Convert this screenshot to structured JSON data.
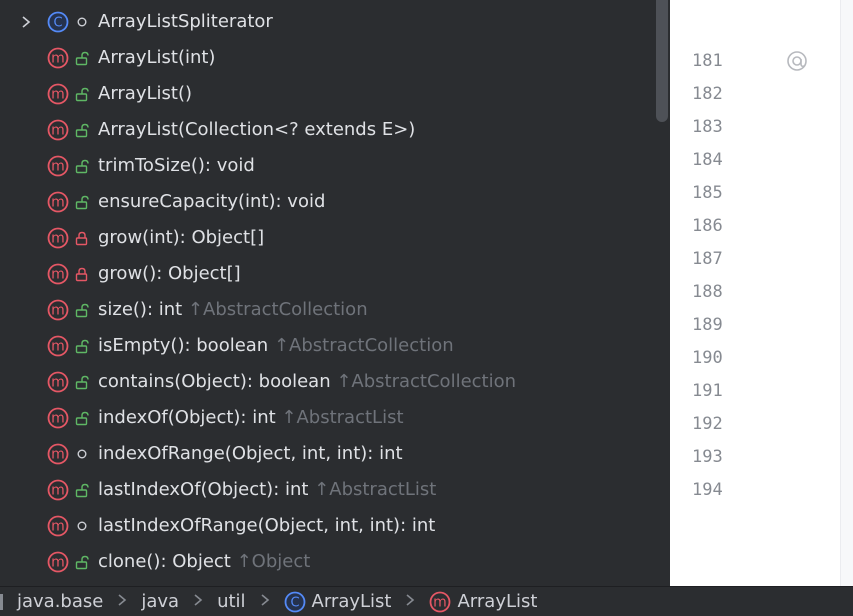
{
  "structure": {
    "items": [
      {
        "kind": "class",
        "visibility": "package",
        "label": "ArrayListSpliterator",
        "suffix": "",
        "expander": true
      },
      {
        "kind": "method",
        "visibility": "public",
        "label": "ArrayList(int)",
        "suffix": ""
      },
      {
        "kind": "method",
        "visibility": "public",
        "label": "ArrayList()",
        "suffix": ""
      },
      {
        "kind": "method",
        "visibility": "public",
        "label": "ArrayList(Collection<? extends E>)",
        "suffix": ""
      },
      {
        "kind": "method",
        "visibility": "public",
        "label": "trimToSize(): void",
        "suffix": ""
      },
      {
        "kind": "method",
        "visibility": "public",
        "label": "ensureCapacity(int): void",
        "suffix": ""
      },
      {
        "kind": "method",
        "visibility": "private",
        "label": "grow(int): Object[]",
        "suffix": ""
      },
      {
        "kind": "method",
        "visibility": "private",
        "label": "grow(): Object[]",
        "suffix": ""
      },
      {
        "kind": "method",
        "visibility": "public",
        "label": "size(): int",
        "suffix": "↑AbstractCollection"
      },
      {
        "kind": "method",
        "visibility": "public",
        "label": "isEmpty(): boolean",
        "suffix": "↑AbstractCollection"
      },
      {
        "kind": "method",
        "visibility": "public",
        "label": "contains(Object): boolean",
        "suffix": "↑AbstractCollection"
      },
      {
        "kind": "method",
        "visibility": "public",
        "label": "indexOf(Object): int",
        "suffix": "↑AbstractList"
      },
      {
        "kind": "method",
        "visibility": "package",
        "label": "indexOfRange(Object, int, int): int",
        "suffix": ""
      },
      {
        "kind": "method",
        "visibility": "public",
        "label": "lastIndexOf(Object): int",
        "suffix": "↑AbstractList"
      },
      {
        "kind": "method",
        "visibility": "package",
        "label": "lastIndexOfRange(Object, int, int): int",
        "suffix": ""
      },
      {
        "kind": "method",
        "visibility": "public",
        "label": "clone(): Object",
        "suffix": "↑Object"
      }
    ]
  },
  "editor": {
    "line_numbers": [
      "181",
      "182",
      "183",
      "184",
      "185",
      "186",
      "187",
      "188",
      "189",
      "190",
      "191",
      "192",
      "193",
      "194"
    ],
    "gutter_icon": "at-annotation-icon"
  },
  "breadcrumb": {
    "items": [
      {
        "label": "java.base",
        "icon": ""
      },
      {
        "label": "java",
        "icon": ""
      },
      {
        "label": "util",
        "icon": ""
      },
      {
        "label": "ArrayList",
        "icon": "class-icon"
      },
      {
        "label": "ArrayList",
        "icon": "method-icon"
      }
    ]
  },
  "colors": {
    "method_icon": "#e55765",
    "class_icon": "#548af7",
    "public_lock": "#5fb865",
    "private_lock": "#e55765",
    "suffix_text": "#6f737a"
  }
}
